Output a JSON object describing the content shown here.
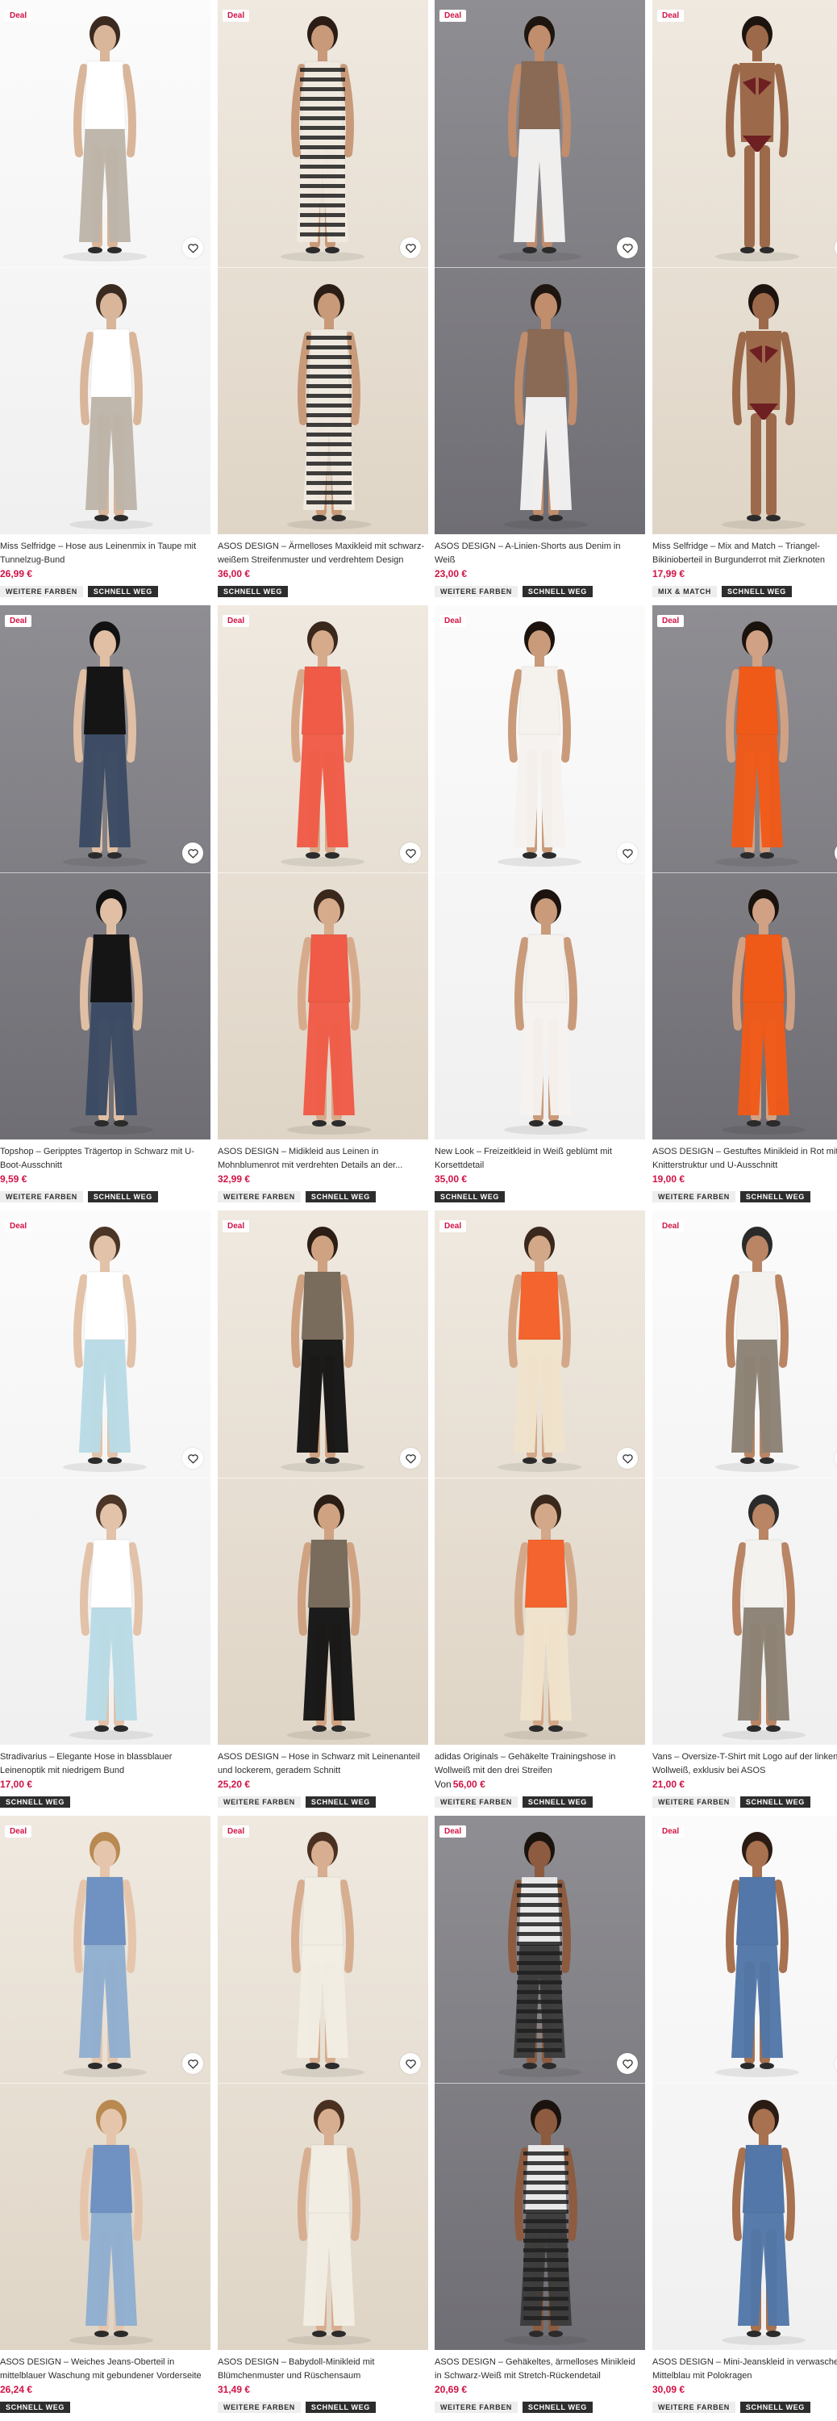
{
  "ui": {
    "deal_label": "Deal",
    "tag_colors": "WEITERE FARBEN",
    "tag_fast": "SCHNELL WEG",
    "tag_mixmatch": "MIX & MATCH",
    "price_from": "Von",
    "price_color": "#d01345"
  },
  "products": [
    {
      "title": "Miss Selfridge – Hose aus Leinenmix in Taupe mit Tunnelzug-Bund",
      "price": "26,99 €",
      "tags": [
        "WEITERE FARBEN",
        "SCHNELL WEG"
      ],
      "deal": true
    },
    {
      "title": "ASOS DESIGN – Ärmelloses Maxikleid mit schwarz-weißem Streifenmuster und verdrehtem Design",
      "price": "36,00 €",
      "tags": [
        "SCHNELL WEG"
      ],
      "deal": true
    },
    {
      "title": "ASOS DESIGN – A-Linien-Shorts aus Denim in Weiß",
      "price": "23,00 €",
      "tags": [
        "WEITERE FARBEN",
        "SCHNELL WEG"
      ],
      "deal": true
    },
    {
      "title": "Miss Selfridge – Mix and Match – Triangel-Bikinioberteil in Burgunderrot mit Zierknoten",
      "price": "17,99 €",
      "tags": [
        "MIX & MATCH",
        "SCHNELL WEG"
      ],
      "deal": true
    },
    {
      "title": "Topshop – Geripptes Trägertop in Schwarz mit U-Boot-Ausschnitt",
      "price": "9,59 €",
      "tags": [
        "WEITERE FARBEN",
        "SCHNELL WEG"
      ],
      "deal": true
    },
    {
      "title": "ASOS DESIGN – Midikleid aus Leinen in Mohnblumenrot mit verdrehten Details an der...",
      "price": "32,99 €",
      "tags": [
        "WEITERE FARBEN",
        "SCHNELL WEG"
      ],
      "deal": true
    },
    {
      "title": "New Look – Freizeitkleid in Weiß geblümt mit Korsettdetail",
      "price": "35,00 €",
      "tags": [
        "SCHNELL WEG"
      ],
      "deal": true
    },
    {
      "title": "ASOS DESIGN – Gestuftes Minikleid in Rot mit Knitterstruktur und U-Ausschnitt",
      "price": "19,00 €",
      "tags": [
        "WEITERE FARBEN",
        "SCHNELL WEG"
      ],
      "deal": true
    },
    {
      "title": "Stradivarius – Elegante Hose in blassblauer Leinenoptik mit niedrigem Bund",
      "price": "17,00 €",
      "tags": [
        "SCHNELL WEG"
      ],
      "deal": true
    },
    {
      "title": "ASOS DESIGN – Hose in Schwarz mit Leinenanteil und lockerem, geradem Schnitt",
      "price": "25,20 €",
      "tags": [
        "WEITERE FARBEN",
        "SCHNELL WEG"
      ],
      "deal": true
    },
    {
      "title": "adidas Originals – Gehäkelte Trainingshose in Wollweiß mit den drei Streifen",
      "price": "56,00 €",
      "price_prefix": "Von",
      "tags": [
        "WEITERE FARBEN",
        "SCHNELL WEG"
      ],
      "deal": true
    },
    {
      "title": "Vans – Oversize-T-Shirt mit Logo auf der linken... in Wollweiß, exklusiv bei ASOS",
      "price": "21,00 €",
      "tags": [
        "WEITERE FARBEN",
        "SCHNELL WEG"
      ],
      "deal": true
    },
    {
      "title": "ASOS DESIGN – Weiches Jeans-Oberteil in mittelblauer Waschung mit gebundener Vorderseite",
      "price": "26,24 €",
      "tags": [
        "SCHNELL WEG"
      ],
      "deal": true
    },
    {
      "title": "ASOS DESIGN – Babydoll-Minikleid mit Blümchenmuster und Rüschensaum",
      "price": "31,49 €",
      "tags": [
        "WEITERE FARBEN",
        "SCHNELL WEG"
      ],
      "deal": true
    },
    {
      "title": "ASOS DESIGN – Gehäkeltes, ärmelloses Minikleid in Schwarz-Weiß mit Stretch-Rückendetail",
      "price": "20,69 €",
      "tags": [
        "WEITERE FARBEN",
        "SCHNELL WEG"
      ],
      "deal": true
    },
    {
      "title": "ASOS DESIGN – Mini-Jeanskleid in verwaschenem Mittelblau mit Polokragen",
      "price": "30,09 €",
      "tags": [
        "WEITERE FARBEN",
        "SCHNELL WEG"
      ],
      "deal": true
    }
  ]
}
